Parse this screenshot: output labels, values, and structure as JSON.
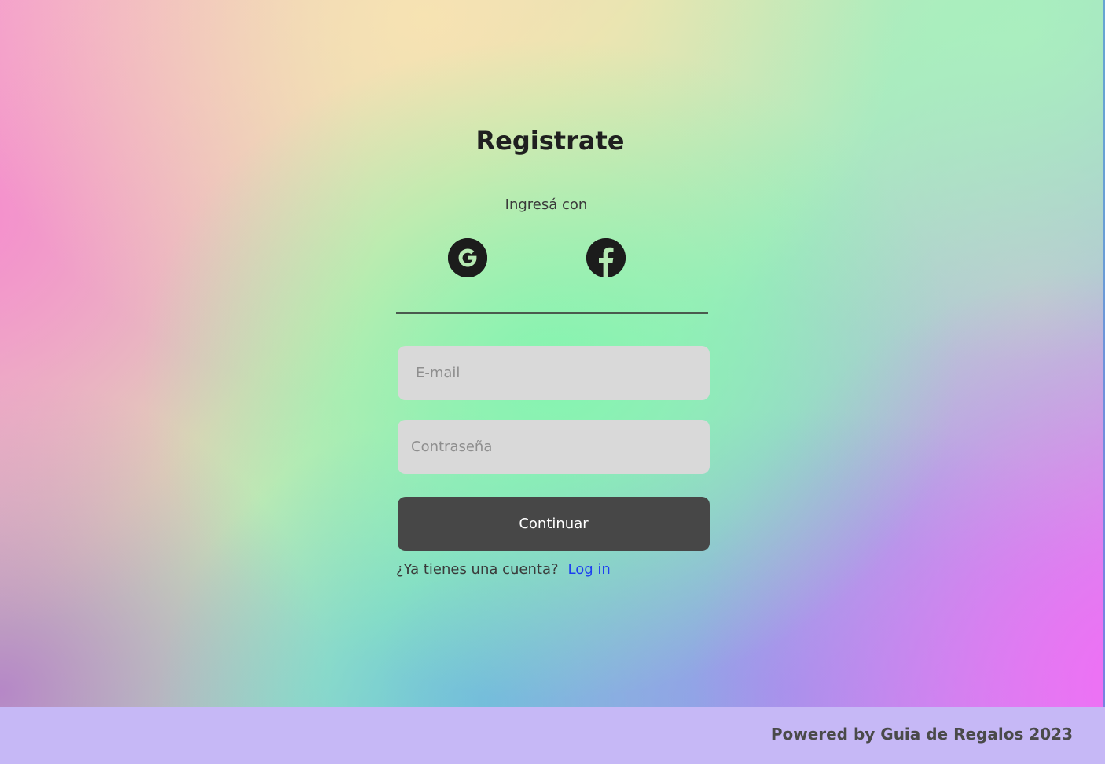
{
  "colors": {
    "button_bg": "#474747",
    "input_bg": "#d9d9d9",
    "link": "#1d3ff0",
    "footer_bg": "#c6b8f6",
    "icon_bg": "#1c1c1c"
  },
  "signup": {
    "title": "Registrate",
    "social_label": "Ingresá con",
    "social_buttons": [
      {
        "icon": "google-icon"
      },
      {
        "icon": "facebook-icon"
      }
    ],
    "email": {
      "placeholder": "E-mail",
      "value": ""
    },
    "password": {
      "placeholder": "Contraseña",
      "value": ""
    },
    "submit_label": "Continuar",
    "login_prompt": "¿Ya tienes una cuenta?",
    "login_link": "Log in"
  },
  "footer": {
    "text": "Powered by Guia de Regalos 2023"
  }
}
